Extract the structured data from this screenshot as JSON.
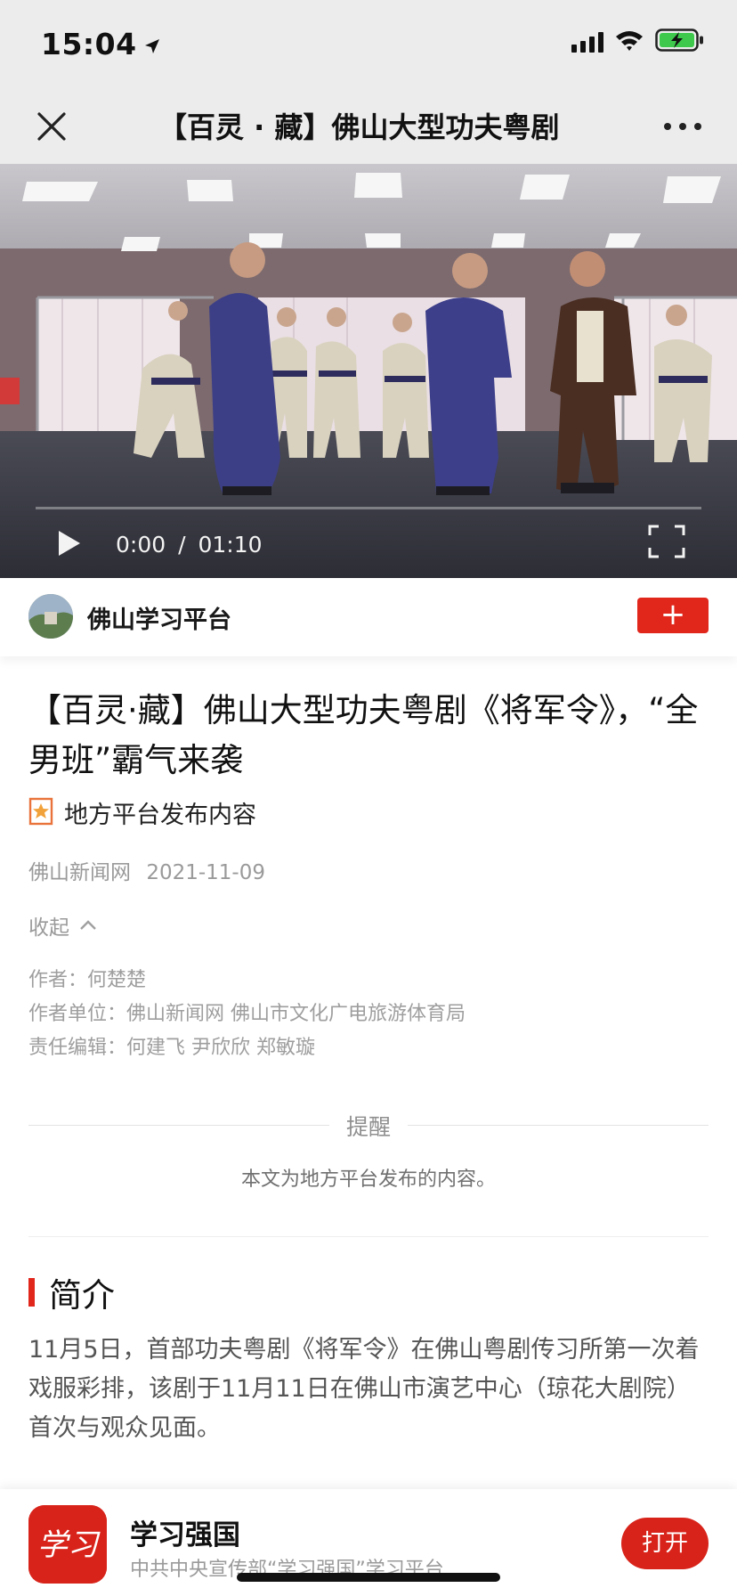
{
  "status_bar": {
    "time": "15:04",
    "icons": [
      "location-arrow-icon",
      "signal-icon",
      "wifi-icon",
      "battery-charging-icon"
    ]
  },
  "nav": {
    "title": "【百灵 · 藏】佛山大型功夫粤剧",
    "close_icon": "close-icon",
    "more_icon": "more-icon"
  },
  "video": {
    "current_time": "0:00",
    "separator": "/",
    "duration": "01:10",
    "progress": 0
  },
  "channel": {
    "name": "佛山学习平台",
    "follow_label": "+"
  },
  "article": {
    "title": "【百灵·藏】佛山大型功夫粤剧《将军令》，“全男班”霸气来袭",
    "tag_label": "地方平台发布内容",
    "source": "佛山新闻网",
    "date": "2021-11-09",
    "collapse_label": "收起",
    "credits": {
      "author_label": "作者：",
      "author": "何楚楚",
      "unit_label": "作者单位：",
      "unit": "佛山新闻网 佛山市文化广电旅游体育局",
      "editor_label": "责任编辑：",
      "editors": "何建飞 尹欣欣 郑敏璇"
    }
  },
  "reminder": {
    "heading": "提醒",
    "text": "本文为地方平台发布的内容。"
  },
  "intro": {
    "heading": "简介",
    "body": "11月5日，首部功夫粤剧《将军令》在佛山粤剧传习所第一次着戏服彩排，该剧于11月11日在佛山市演艺中心（琼花大剧院）首次与观众见面。"
  },
  "app_banner": {
    "name": "学习强国",
    "description": "中共中央宣传部“学习强国”学习平台",
    "open_label": "打开",
    "logo_text": "学习"
  },
  "colors": {
    "accent": "#e1261c",
    "header_bg": "#ececec",
    "meta_gray": "#9a9a9a"
  }
}
